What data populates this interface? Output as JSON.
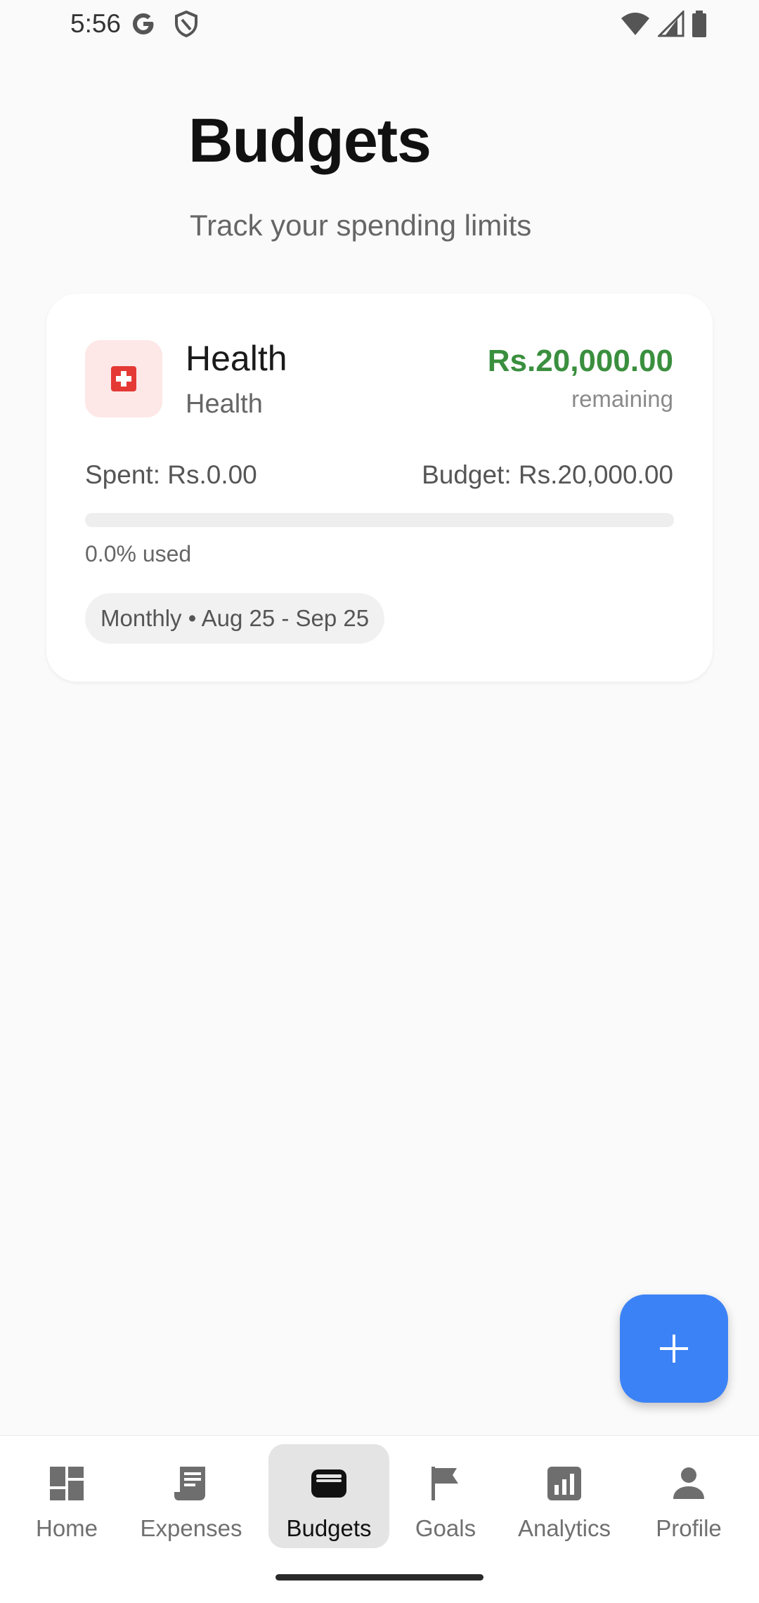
{
  "status_bar": {
    "time": "5:56",
    "icons": [
      "google-g-icon",
      "shield-icon",
      "wifi-icon",
      "signal-icon",
      "battery-icon"
    ]
  },
  "header": {
    "title": "Budgets",
    "subtitle": "Track your spending limits"
  },
  "budget_card": {
    "icon": "medical-cross-icon",
    "icon_color": "#E53935",
    "icon_bg": "#FDE7E7",
    "title": "Health",
    "category": "Health",
    "remaining_amount": "Rs.20,000.00",
    "remaining_label": "remaining",
    "remaining_color": "#3A8F3E",
    "spent": "Spent: Rs.0.00",
    "budget": "Budget: Rs.20,000.00",
    "used_fraction": 0.0,
    "used_text": "0.0% used",
    "period": "Monthly • Aug 25 - Sep 25"
  },
  "fab": {
    "icon": "plus-icon",
    "color": "#3B82F6"
  },
  "bottom_nav": {
    "items": [
      {
        "label": "Home",
        "icon": "dashboard-icon",
        "active": false
      },
      {
        "label": "Expenses",
        "icon": "receipt-icon",
        "active": false
      },
      {
        "label": "Budgets",
        "icon": "wallet-icon",
        "active": true
      },
      {
        "label": "Goals",
        "icon": "flag-icon",
        "active": false
      },
      {
        "label": "Analytics",
        "icon": "analytics-icon",
        "active": false
      },
      {
        "label": "Profile",
        "icon": "person-icon",
        "active": false
      }
    ]
  }
}
